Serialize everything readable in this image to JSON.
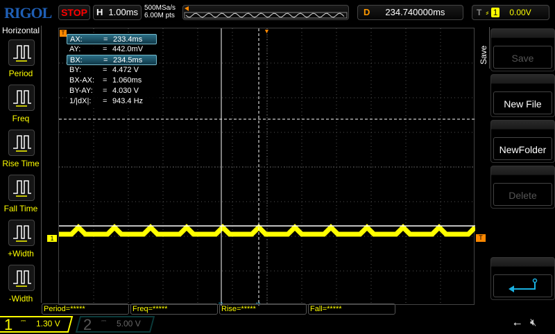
{
  "header": {
    "logo": "RIGOL",
    "run_state": "STOP",
    "h_label": "H",
    "timebase": "1.00ms",
    "sample_rate": "500MSa/s",
    "memory_depth": "6.00M pts",
    "d_label": "D",
    "delay": "234.740000ms",
    "t_label": "T",
    "trigger_source": "1",
    "trigger_level": "0.00V"
  },
  "left_menu": {
    "title": "Horizontal",
    "items": [
      {
        "label": "Period",
        "icon": "period-icon"
      },
      {
        "label": "Freq",
        "icon": "frequency-icon"
      },
      {
        "label": "Rise Time",
        "icon": "rise-time-icon"
      },
      {
        "label": "Fall Time",
        "icon": "fall-time-icon"
      },
      {
        "label": "+Width",
        "icon": "positive-width-icon"
      },
      {
        "label": "-Width",
        "icon": "negative-width-icon"
      }
    ]
  },
  "cursor_table": [
    {
      "k": "AX:",
      "eq": "=",
      "v": "233.4ms",
      "sel": true
    },
    {
      "k": "AY:",
      "eq": "=",
      "v": "442.0mV"
    },
    {
      "k": "BX:",
      "eq": "=",
      "v": "234.5ms",
      "sel": true
    },
    {
      "k": "BY:",
      "eq": "=",
      "v": "4.472 V"
    },
    {
      "k": "BX-AX:",
      "eq": "=",
      "v": "1.060ms"
    },
    {
      "k": "BY-AY:",
      "eq": "=",
      "v": "4.030 V"
    },
    {
      "k": "1/|dX|:",
      "eq": "=",
      "v": "943.4 Hz"
    }
  ],
  "right_menu": {
    "title": "Save",
    "buttons": [
      {
        "label": "Save",
        "enabled": false
      },
      {
        "label": "New File",
        "enabled": true
      },
      {
        "label": "NewFolder",
        "enabled": true
      },
      {
        "label": "Delete",
        "enabled": false
      }
    ],
    "back_icon": "return-arrow-icon"
  },
  "measurements": [
    "Period=*****",
    "Freq=*****",
    "Rise=*****",
    "Fall=*****"
  ],
  "channels": [
    {
      "num": "1",
      "coupling": "DC",
      "scale": "1.30 V",
      "color": "#ffff00",
      "active": true
    },
    {
      "num": "2",
      "coupling": "DC",
      "scale": "5.00 V",
      "color": "#00a0a0",
      "active": false
    }
  ],
  "status_icons": [
    "usb-icon",
    "speaker-muted-icon"
  ],
  "colors": {
    "ch1": "#ffff00",
    "trigger": "#ff8c00",
    "cursor": "#ffffff",
    "accent": "#1ab0e0"
  }
}
